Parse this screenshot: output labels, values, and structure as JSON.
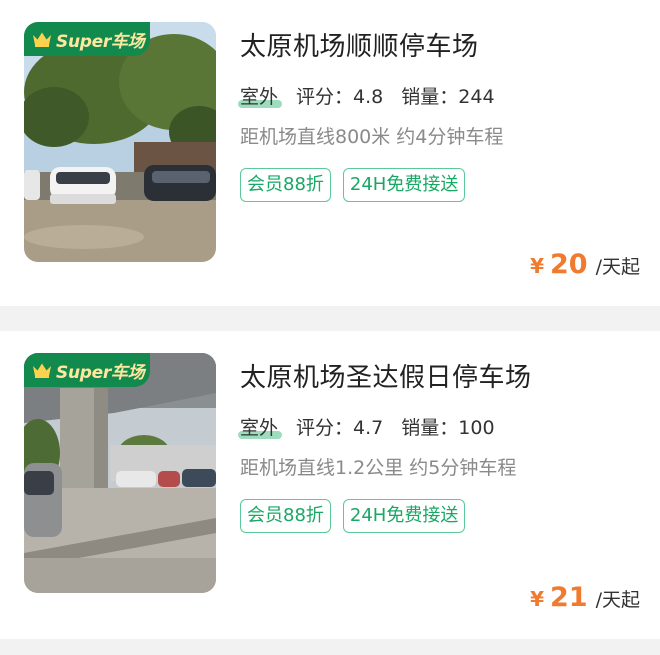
{
  "colors": {
    "accent_green": "#18a864",
    "badge_green": "#138a4d",
    "price_orange": "#f07a2d"
  },
  "listings": [
    {
      "badge": {
        "icon": "crown-icon",
        "text": "Super车场"
      },
      "name": "太原机场顺顺停车场",
      "location_type": "室外",
      "rating_label": "评分：",
      "rating": "4.8",
      "sales_label": "销量：",
      "sales": "244",
      "distance": "距机场直线800米 约4分钟车程",
      "tags": [
        "会员88折",
        "24H免费接送"
      ],
      "price": {
        "currency": "¥",
        "amount": "20",
        "unit": "/天起"
      },
      "photo_icon": "parking-lot-photo"
    },
    {
      "badge": {
        "icon": "crown-icon",
        "text": "Super车场"
      },
      "name": "太原机场圣达假日停车场",
      "location_type": "室外",
      "rating_label": "评分：",
      "rating": "4.7",
      "sales_label": "销量：",
      "sales": "100",
      "distance": "距机场直线1.2公里 约5分钟车程",
      "tags": [
        "会员88折",
        "24H免费接送"
      ],
      "price": {
        "currency": "¥",
        "amount": "21",
        "unit": "/天起"
      },
      "photo_icon": "parking-lot-photo"
    }
  ]
}
